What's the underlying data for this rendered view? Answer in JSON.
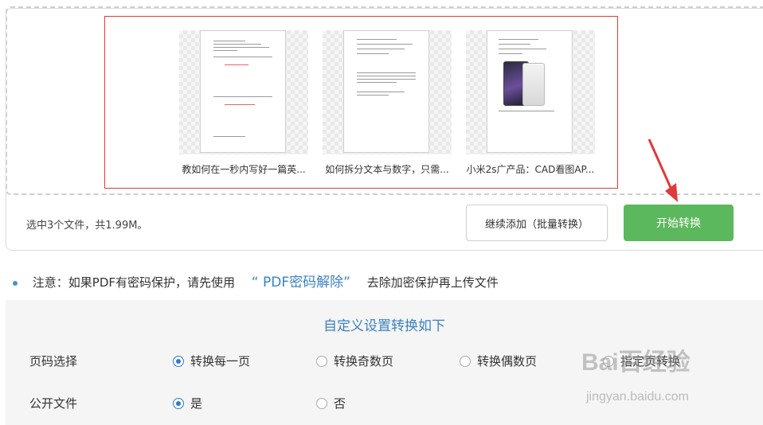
{
  "files": [
    {
      "name": "教如何在一秒内写好一篇英..."
    },
    {
      "name": "如何拆分文本与数字，只需..."
    },
    {
      "name": "小米2s广产品：CAD看图AP..."
    }
  ],
  "summary": "选中3个文件，共1.99M。",
  "buttons": {
    "add": "继续添加（批量转换）",
    "start": "开始转换"
  },
  "notice": {
    "prefix": "注意：如果PDF有密码保护，请先使用",
    "link": "“ PDF密码解除”",
    "suffix": "去除加密保护再上传文件"
  },
  "settings": {
    "title": "自定义设置转换如下",
    "page_label": "页码选择",
    "page_options": [
      "转换每一页",
      "转换奇数页",
      "转换偶数页",
      "指定页转换"
    ],
    "page_selected": "转换每一页",
    "public_label": "公开文件",
    "public_options": [
      "是",
      "否"
    ],
    "public_selected": "是"
  },
  "watermark": {
    "brand": "Bai百经验",
    "url": "jingyan.baidu.com"
  },
  "colors": {
    "start_button": "#5cb85c",
    "link": "#3b82c4",
    "highlight_border": "#e03a3a",
    "radio_checked": "#2f7ad1"
  }
}
